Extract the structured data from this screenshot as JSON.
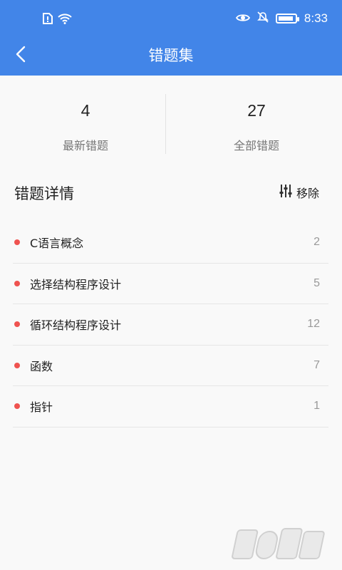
{
  "status_bar": {
    "time": "8:33",
    "icons": [
      "sim-alert-icon",
      "wifi-icon",
      "eye-icon",
      "bell-off-icon",
      "battery-icon"
    ],
    "battery_level": 0.92
  },
  "navbar": {
    "title": "错题集"
  },
  "stats": [
    {
      "number": "4",
      "label": "最新错题"
    },
    {
      "number": "27",
      "label": "全部错题"
    }
  ],
  "section": {
    "title": "错题详情",
    "remove_label": "移除"
  },
  "topics": [
    {
      "name": "C语言概念",
      "count": "2"
    },
    {
      "name": "选择结构程序设计",
      "count": "5"
    },
    {
      "name": "循环结构程序设计",
      "count": "12"
    },
    {
      "name": "函数",
      "count": "7"
    },
    {
      "name": "指针",
      "count": "1"
    }
  ],
  "colors": {
    "primary": "#4285e8",
    "dot": "#ef5350"
  }
}
